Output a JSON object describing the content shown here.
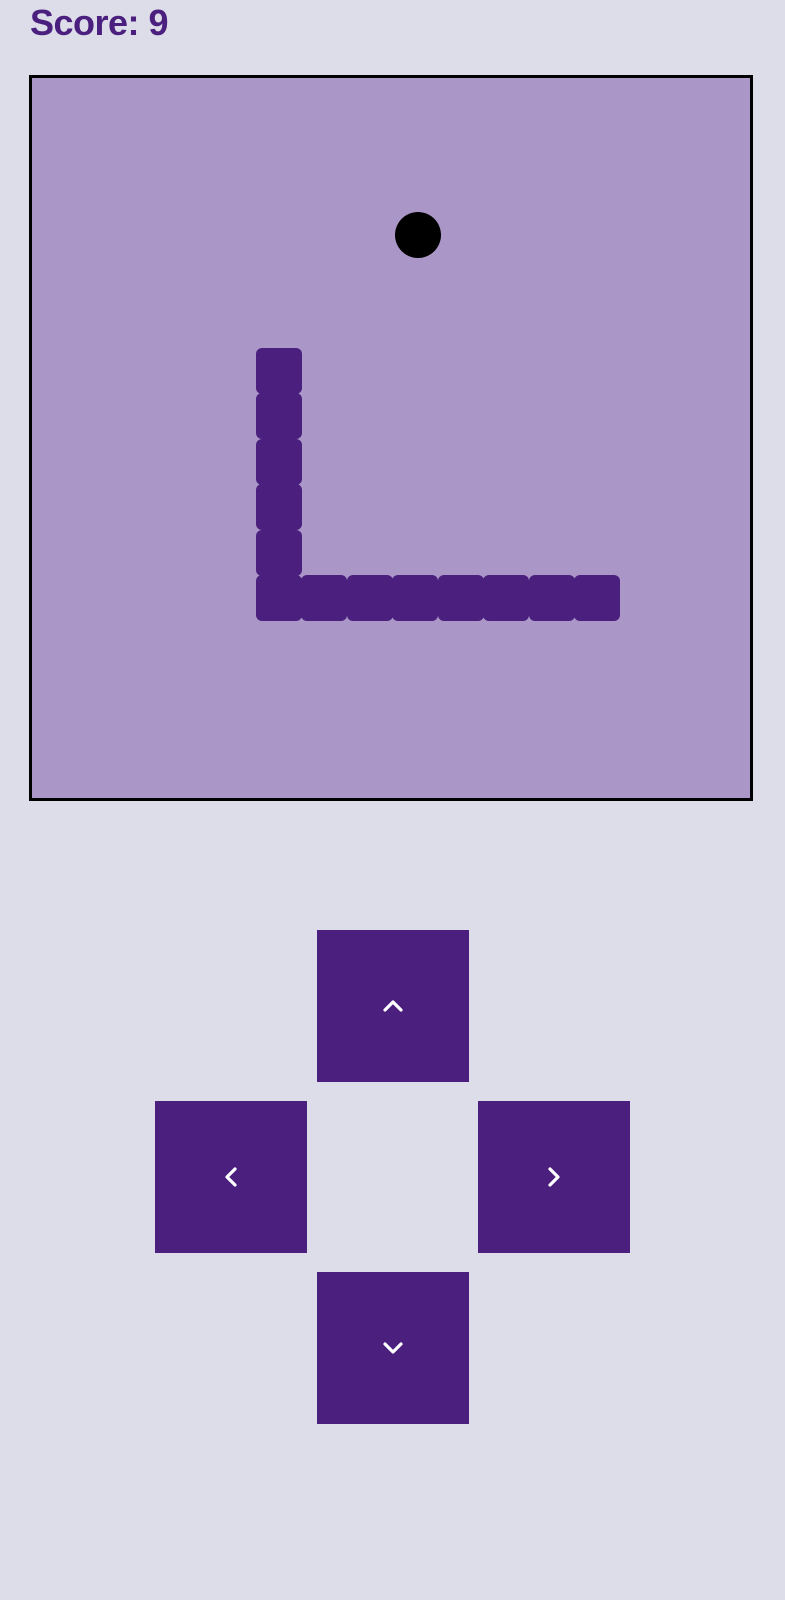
{
  "score": {
    "label": "Score: 9"
  },
  "game": {
    "theme": {
      "background": "#dddce9",
      "board": "#ab97c7",
      "snake": "#4a1f7e",
      "food": "#000000",
      "text": "#4a1f7e"
    }
  },
  "controls": {
    "up_icon": "chevron-up-icon",
    "left_icon": "chevron-left-icon",
    "right_icon": "chevron-right-icon",
    "down_icon": "chevron-down-icon"
  }
}
